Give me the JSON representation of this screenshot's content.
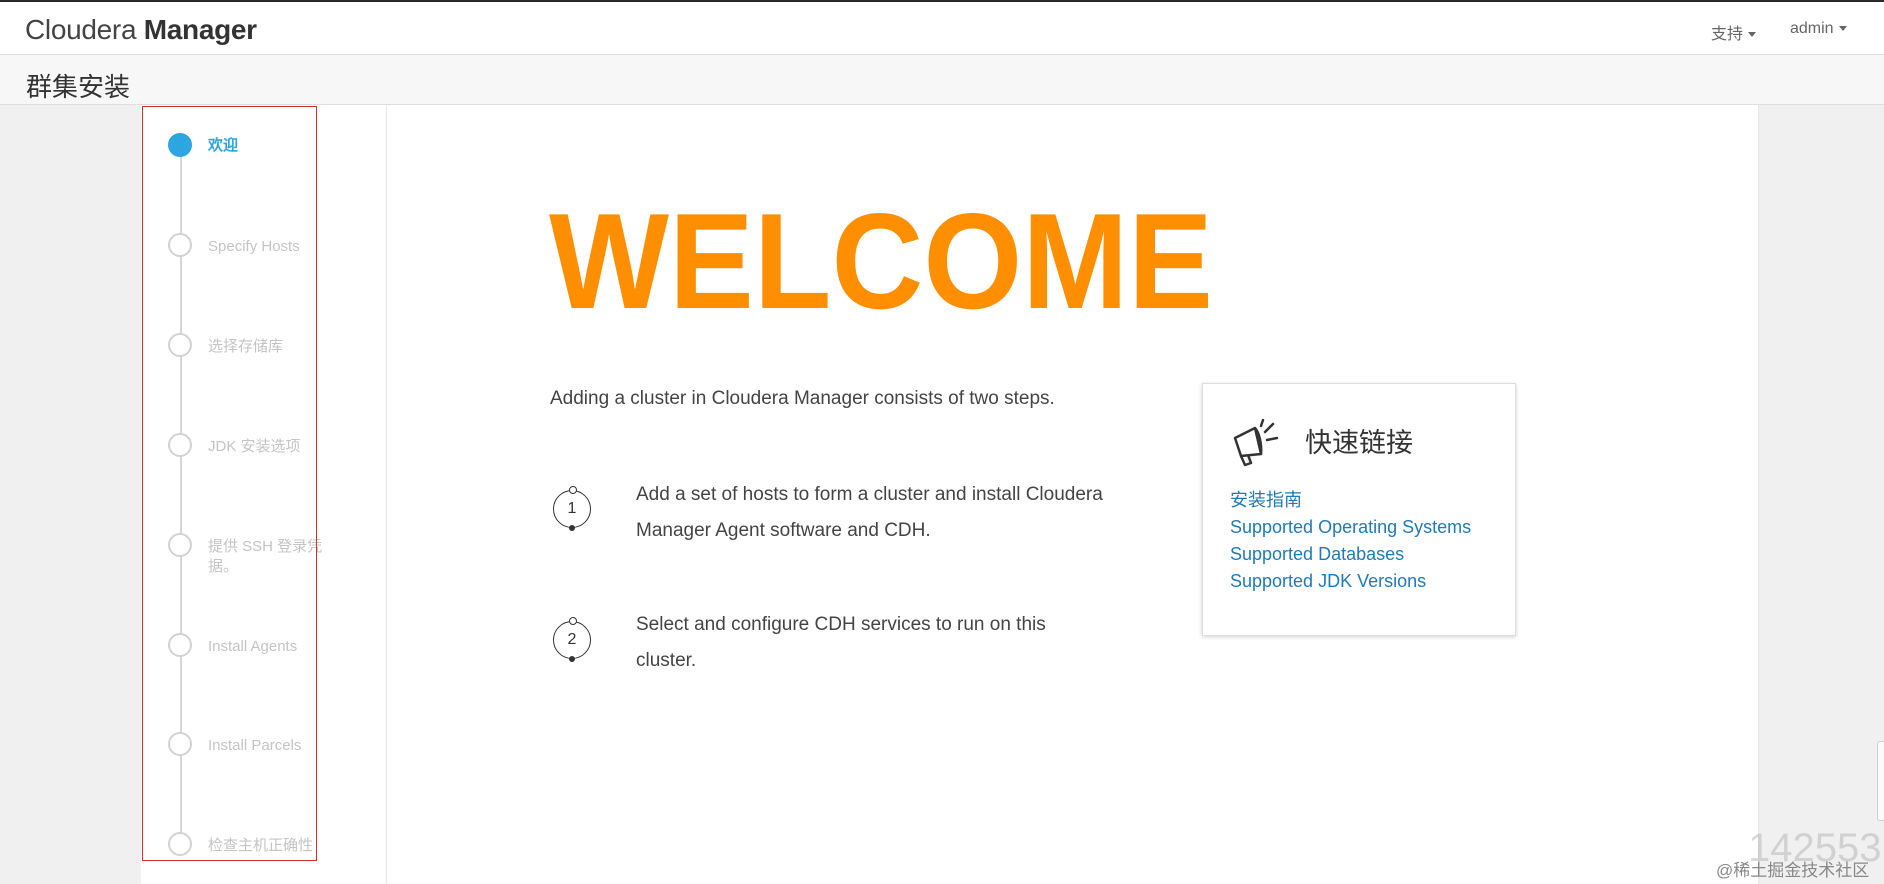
{
  "header": {
    "brand_light": "Cloudera",
    "brand_bold": "Manager",
    "support_label": "支持",
    "user_label": "admin"
  },
  "page": {
    "title": "群集安装"
  },
  "wizard": {
    "accent_color": "#2ba6e0",
    "steps": [
      {
        "label": "欢迎",
        "active": true
      },
      {
        "label": "Specify Hosts",
        "active": false
      },
      {
        "label": "选择存储库",
        "active": false
      },
      {
        "label": "JDK 安装选项",
        "active": false
      },
      {
        "label": "提供 SSH 登录凭据。",
        "active": false
      },
      {
        "label": "Install Agents",
        "active": false
      },
      {
        "label": "Install Parcels",
        "active": false
      },
      {
        "label": "检查主机正确性",
        "active": false
      }
    ]
  },
  "main": {
    "welcome_text": "WELCOME",
    "welcome_color": "#ff8f00",
    "intro": "Adding a cluster in Cloudera Manager consists of two steps.",
    "steps": [
      {
        "number": "1",
        "text": "Add a set of hosts to form a cluster and install Cloudera Manager Agent software and CDH."
      },
      {
        "number": "2",
        "text": "Select and configure CDH services to run on this cluster."
      }
    ]
  },
  "quick_links": {
    "icon": "megaphone-icon",
    "title": "快速链接",
    "links": [
      "安装指南",
      "Supported Operating Systems",
      "Supported Databases",
      "Supported JDK Versions"
    ]
  },
  "watermark": {
    "number": "142553",
    "site": "@稀土掘金技术社区"
  }
}
